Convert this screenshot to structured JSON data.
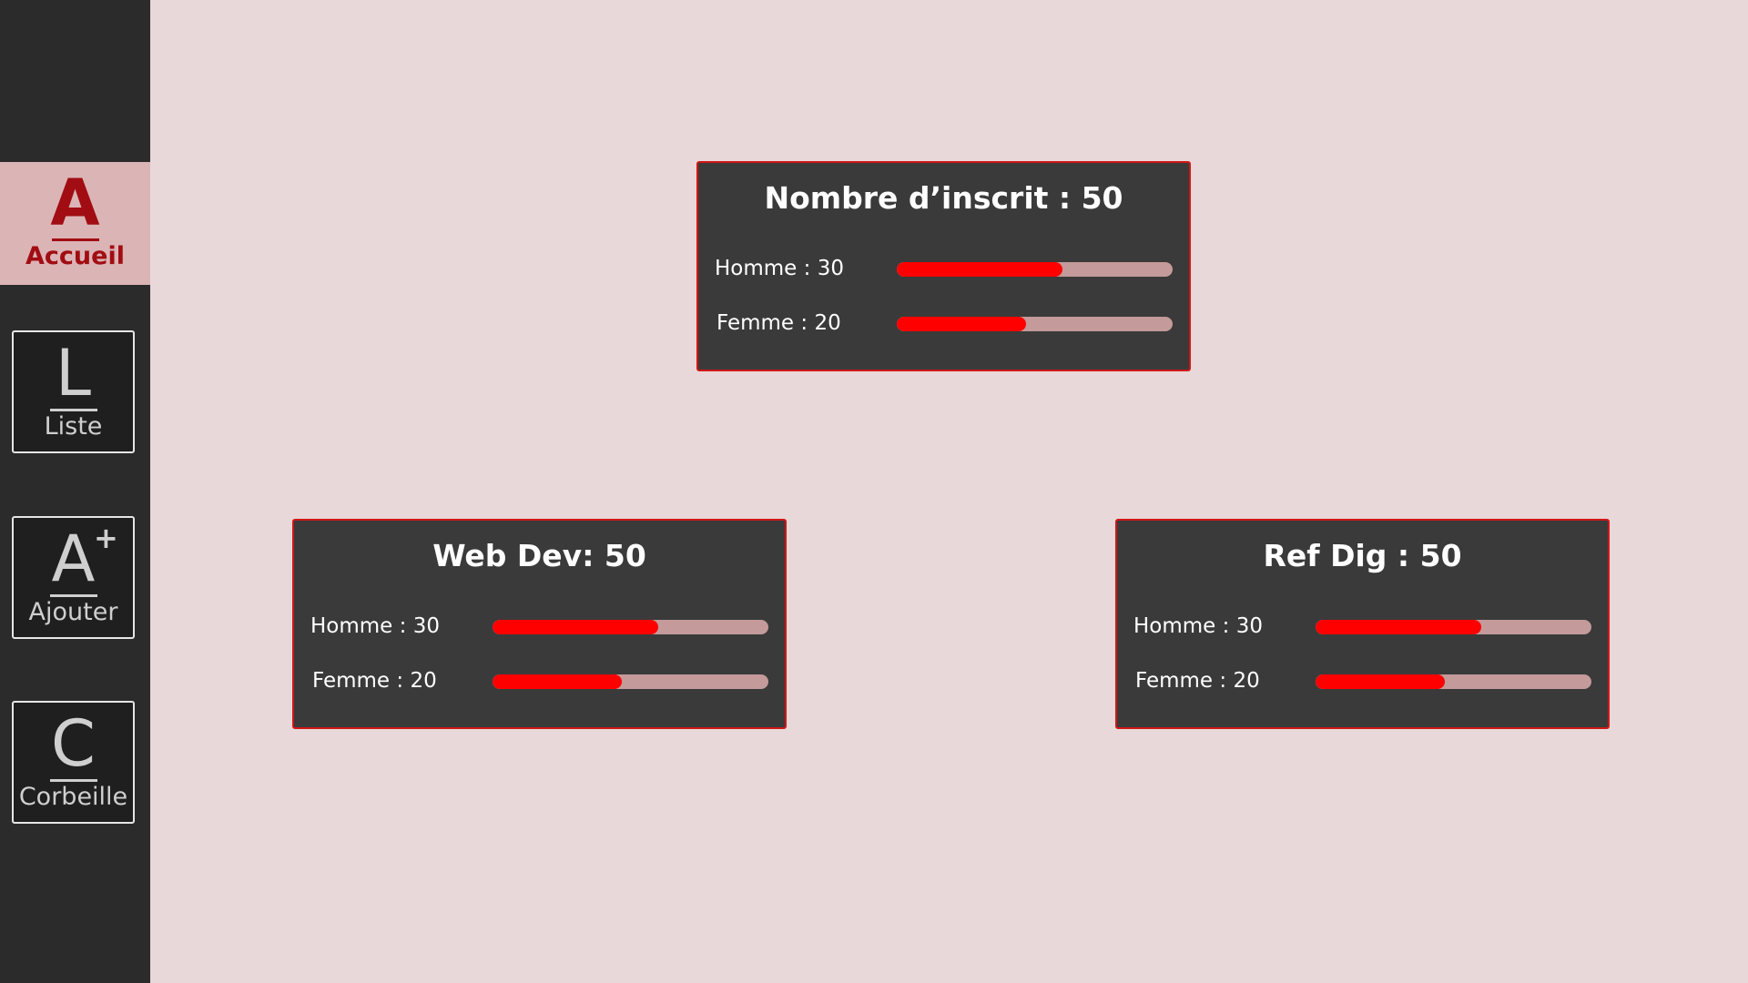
{
  "sidebar": {
    "items": [
      {
        "letter": "A",
        "label": "Accueil",
        "active": true
      },
      {
        "letter": "L",
        "label": "Liste",
        "active": false
      },
      {
        "letter": "A",
        "superscript": "+",
        "label": "Ajouter",
        "active": false
      },
      {
        "letter": "C",
        "label": "Corbeille",
        "active": false
      }
    ]
  },
  "cards": {
    "total": {
      "title": "Nombre d’inscrit : 50",
      "homme_label": "Homme : 30",
      "homme_fraction": 0.6,
      "femme_label": "Femme : 20",
      "femme_fraction": 0.47
    },
    "webdev": {
      "title": "Web Dev: 50",
      "homme_label": "Homme : 30",
      "homme_fraction": 0.6,
      "femme_label": "Femme : 20",
      "femme_fraction": 0.47
    },
    "refdig": {
      "title": "Ref Dig : 50",
      "homme_label": "Homme : 30",
      "homme_fraction": 0.6,
      "femme_label": "Femme : 20",
      "femme_fraction": 0.47
    }
  },
  "colors": {
    "background": "#e9d8d9",
    "sidebar": "#2b2b2b",
    "active_nav": "#dbb4b6",
    "accent": "#a10d12",
    "card": "#3a3a3a",
    "card_border": "#d01616",
    "bar_fill": "#ff0000",
    "bar_track": "#c49a9b"
  }
}
